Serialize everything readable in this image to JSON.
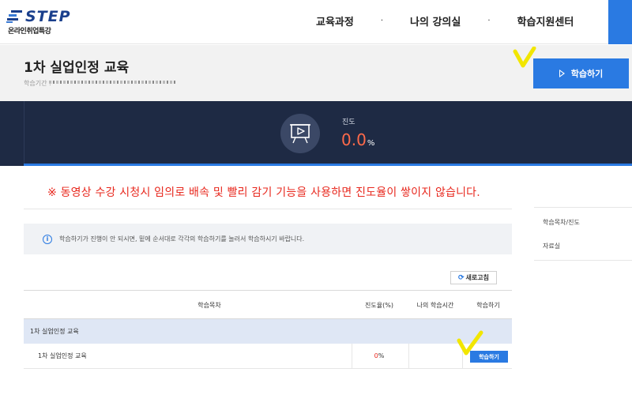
{
  "header": {
    "logo_word": "STEP",
    "logo_sub": "온라인취업특강",
    "nav": [
      "교육과정",
      "나의 강의실",
      "학습지원센터"
    ],
    "nav_separator": "·",
    "accent_color": "#2a7ae2"
  },
  "course": {
    "title": "1차 실업인정 교육",
    "period_label": "학습기간 :",
    "start_button": "학습하기"
  },
  "progress": {
    "label": "진도",
    "value": "0.0",
    "unit": "%",
    "icon": "video-lecture-icon",
    "value_color": "#ff6a4a"
  },
  "notice": "※ 동영상 수강 시청시 임의로 배속 및 빨리 감기 기능을 사용하면 진도율이 쌓이지 않습니다.",
  "side_menu": [
    "학습목차/진도",
    "자료실"
  ],
  "info": {
    "icon": "info-icon",
    "text": "학습하기가 진행이 안 되시면, 밑에 순서대로 각각의 학습하기를 눌러서 학습하시기 바랍니다."
  },
  "refresh_button": "새로고침",
  "table": {
    "headers": {
      "toc": "학습목차",
      "progress": "진도율(%)",
      "my_time": "나의 학습시간",
      "action": "학습하기"
    },
    "section_title": "1차 실업인정 교육",
    "rows": [
      {
        "name": "1차 실업인정 교육",
        "progress_num": "0",
        "progress_unit": "%",
        "my_time": "",
        "button": "학습하기"
      }
    ]
  }
}
